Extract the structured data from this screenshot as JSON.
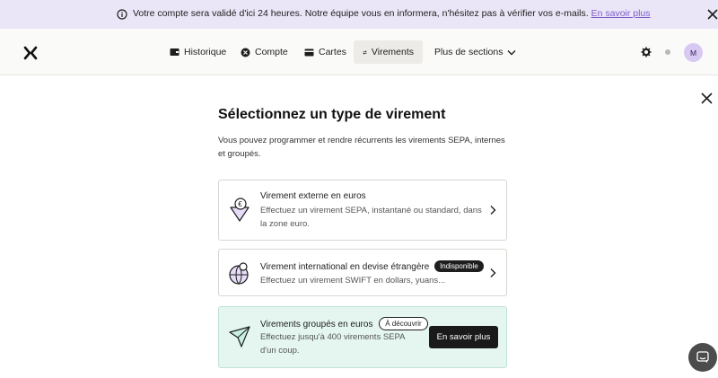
{
  "banner": {
    "message": "Votre compte sera validé d'ici 24 heures. Notre équipe vous en informera, n'hésitez pas à vérifier vos e-mails.",
    "link": "En savoir plus",
    "icon": "info-icon",
    "close_icon": "close-icon"
  },
  "nav": {
    "logo_icon": "logo-x-icon",
    "items": [
      {
        "label": "Historique",
        "icon": "wallet-icon"
      },
      {
        "label": "Compte",
        "icon": "account-icon"
      },
      {
        "label": "Cartes",
        "icon": "card-icon"
      },
      {
        "label": "Virements",
        "icon": "transfer-icon",
        "active": true
      },
      {
        "label": "Plus de sections",
        "icon": "chevron-down-icon"
      }
    ],
    "avatar_initial": "M"
  },
  "modal": {
    "title": "Sélectionnez un type de virement",
    "subtitle": "Vous pouvez programmer et rendre récurrents les virements SEPA, internes et groupés."
  },
  "cards": [
    {
      "title": "Virement externe en euros",
      "description": "Effectuez un virement SEPA, instantané ou standard, dans la zone euro."
    },
    {
      "title": "Virement international en devise étrangère",
      "badge": "Indisponible",
      "description": "Effectuez un virement SWIFT en dollars, yuans..."
    },
    {
      "title": "Virements groupés en euros",
      "badge": "À découvrir",
      "description": "Effectuez jusqu'à 400 virements SEPA d'un coup.",
      "button": "En savoir plus"
    }
  ],
  "colors": {
    "banner_bg": "#ebe6f7",
    "link": "#7b5cc7",
    "highlight_card_bg": "#e4f6ef",
    "avatar_bg": "#d8c9f3"
  }
}
